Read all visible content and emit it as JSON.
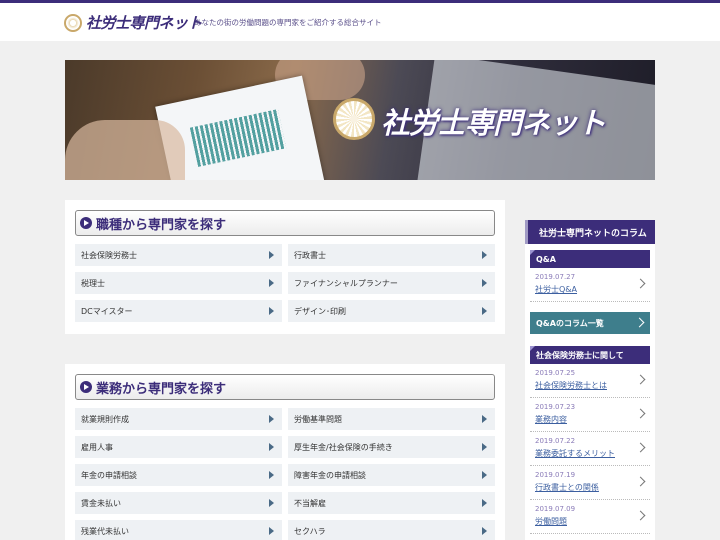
{
  "header": {
    "logo_text": "社労士専門ネット",
    "tagline": "あなたの街の労働問題の専門家をご紹介する総合サイト"
  },
  "hero": {
    "title": "社労士専門ネット"
  },
  "section_occupation": {
    "title": "職種から専門家を探す",
    "items": [
      "社会保険労務士",
      "行政書士",
      "税理士",
      "ファイナンシャルプランナー",
      "DCマイスター",
      "デザイン･印刷"
    ]
  },
  "section_business": {
    "title": "業務から専門家を探す",
    "items": [
      "就業規則作成",
      "労働基準問題",
      "雇用人事",
      "厚生年金/社会保険の手続き",
      "年金の申請相談",
      "障害年金の申請相談",
      "賃金未払い",
      "不当解雇",
      "残業代未払い",
      "セクハラ"
    ]
  },
  "sidebar": {
    "title": "社労士専門ネットのコラム",
    "qa": {
      "heading": "Q&A",
      "posts": [
        {
          "date": "2019.07.27",
          "title": "社労士Q&A"
        }
      ],
      "more_label": "Q&Aのコラム一覧"
    },
    "about": {
      "heading": "社会保険労務士に関して",
      "posts": [
        {
          "date": "2019.07.25",
          "title": "社会保険労務士とは"
        },
        {
          "date": "2019.07.23",
          "title": "業務内容"
        },
        {
          "date": "2019.07.22",
          "title": "業務委託するメリット"
        },
        {
          "date": "2019.07.19",
          "title": "行政書士との関係"
        },
        {
          "date": "2019.07.09",
          "title": "労働問題"
        }
      ]
    }
  },
  "colors": {
    "brand": "#3c2d7a",
    "teal": "#3e7e8c",
    "gold": "#c9a86a"
  }
}
